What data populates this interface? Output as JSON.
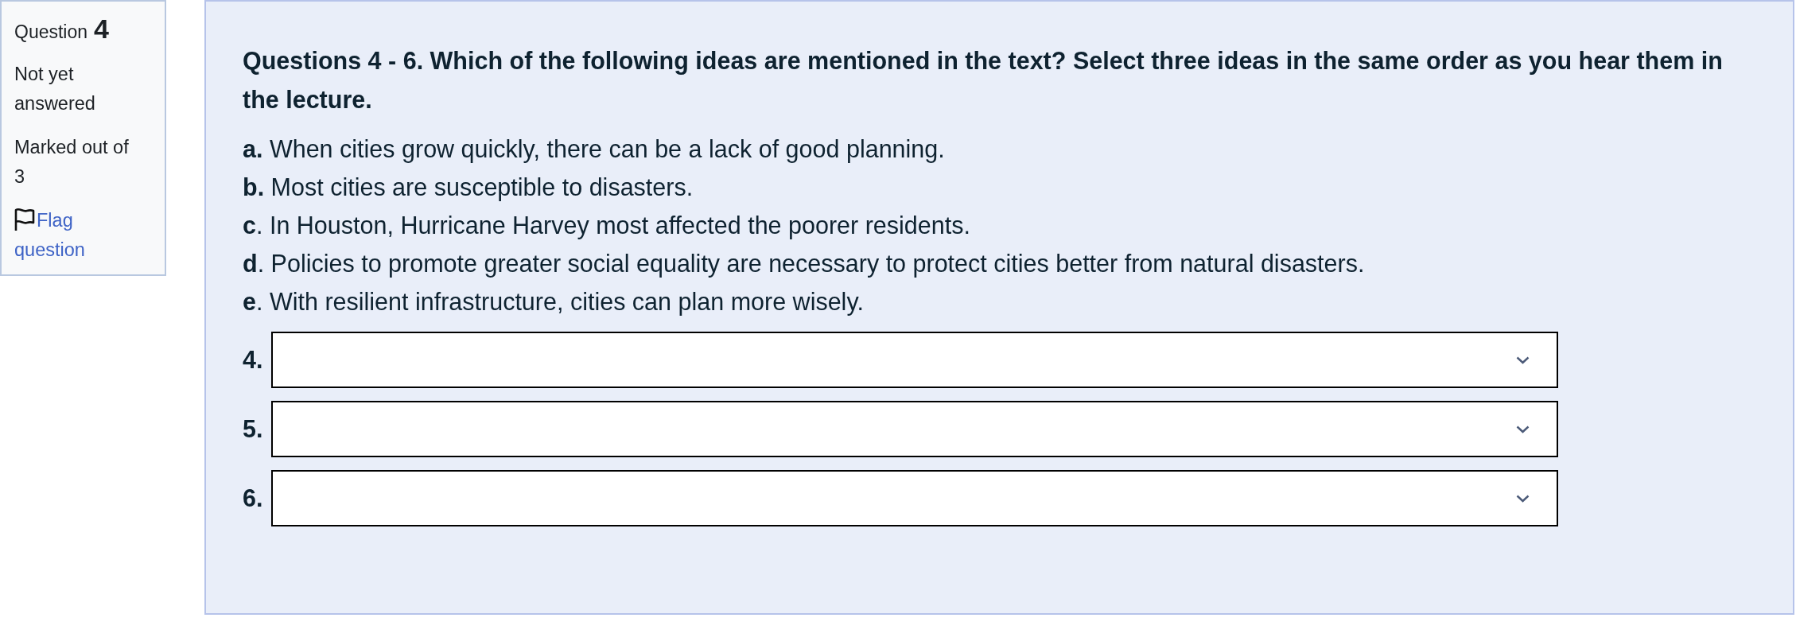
{
  "question_info": {
    "label": "Question",
    "number": "4",
    "status": "Not yet answered",
    "marks": "Marked out of 3",
    "flag": {
      "label": "Flag question",
      "flagged": false
    }
  },
  "question": {
    "prompt": "Questions 4 - 6. Which of the following ideas are mentioned in the text? Select three ideas in the same order as you hear them in the lecture.",
    "options": [
      "**a.** When cities grow quickly, there can be a lack of good planning.",
      "**b.** Most cities are susceptible to disasters.",
      "**c**. In Houston, Hurricane Harvey most affected the poorer residents.",
      "**d**. Policies to promote greater social equality are necessary to protect cities better from natural disasters.",
      "**e**. With resilient infrastructure, cities can plan more wisely."
    ],
    "answers": [
      {
        "label": "4."
      },
      {
        "label": "5."
      },
      {
        "label": "6."
      }
    ]
  }
}
